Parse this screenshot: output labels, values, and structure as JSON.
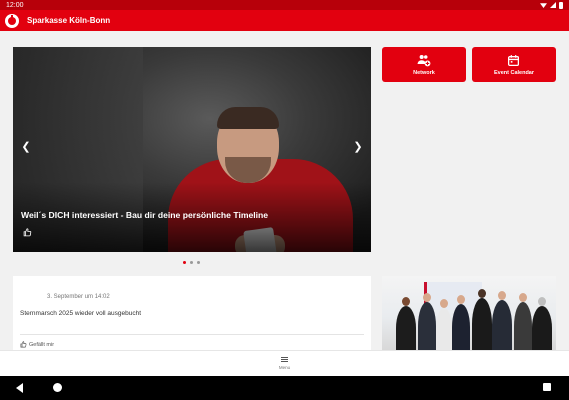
{
  "status_bar": {
    "time": "12:00"
  },
  "app_bar": {
    "title": "Sparkasse Köln-Bonn"
  },
  "hero": {
    "caption": "Weil´s DICH interessiert - Bau dir deine persönliche Timeline",
    "like_icon": "thumbs-up-icon",
    "prev_icon": "chevron-left-icon",
    "next_icon": "chevron-right-icon",
    "slide_count": 3,
    "active_slide": 1
  },
  "tiles": [
    {
      "label": "Network",
      "icon": "people-add-icon"
    },
    {
      "label": "Event Calendar",
      "icon": "calendar-icon"
    }
  ],
  "post": {
    "date": "3. September um 14:02",
    "text": "Sternmarsch 2025 wieder voll ausgebucht",
    "like_label": "Gefällt mir"
  },
  "menu": {
    "label": "Menu",
    "icon": "hamburger-icon"
  },
  "colors": {
    "brand": "#e2000f",
    "status_bar": "#b7000a",
    "background": "#f1f1f1"
  }
}
